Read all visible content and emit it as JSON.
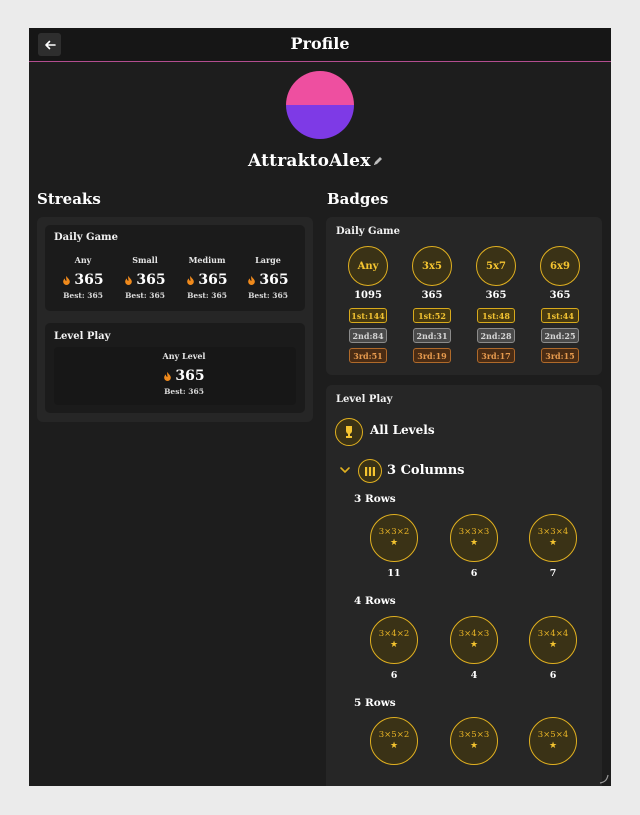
{
  "header": {
    "title": "Profile",
    "back_icon": "arrow-left-icon"
  },
  "profile": {
    "username": "AttraktoAlex",
    "avatar_colors": [
      "#ee4fa0",
      "#7e3ae6"
    ]
  },
  "streaks": {
    "title": "Streaks",
    "daily_game": {
      "title": "Daily Game",
      "items": [
        {
          "label": "Any",
          "value": "365",
          "best": "Best: 365"
        },
        {
          "label": "Small",
          "value": "365",
          "best": "Best: 365"
        },
        {
          "label": "Medium",
          "value": "365",
          "best": "Best: 365"
        },
        {
          "label": "Large",
          "value": "365",
          "best": "Best: 365"
        }
      ]
    },
    "level_play": {
      "title": "Level Play",
      "item": {
        "label": "Any Level",
        "value": "365",
        "best": "Best: 365"
      }
    }
  },
  "badges": {
    "title": "Badges",
    "daily_game": {
      "title": "Daily Game",
      "items": [
        {
          "label": "Any",
          "count": "1095",
          "first": "1st:144",
          "second": "2nd:84",
          "third": "3rd:51"
        },
        {
          "label": "3x5",
          "count": "365",
          "first": "1st:52",
          "second": "2nd:31",
          "third": "3rd:19"
        },
        {
          "label": "5x7",
          "count": "365",
          "first": "1st:48",
          "second": "2nd:28",
          "third": "3rd:17"
        },
        {
          "label": "6x9",
          "count": "365",
          "first": "1st:44",
          "second": "2nd:25",
          "third": "3rd:15"
        }
      ]
    },
    "level_play": {
      "title": "Level Play",
      "all_levels": "All Levels",
      "columns_group": "3 Columns",
      "rows": [
        {
          "title": "3 Rows",
          "badges": [
            {
              "label": "3×3×2",
              "count": "11"
            },
            {
              "label": "3×3×3",
              "count": "6"
            },
            {
              "label": "3×3×4",
              "count": "7"
            }
          ]
        },
        {
          "title": "4 Rows",
          "badges": [
            {
              "label": "3×4×2",
              "count": "6"
            },
            {
              "label": "3×4×3",
              "count": "4"
            },
            {
              "label": "3×4×4",
              "count": "6"
            }
          ]
        },
        {
          "title": "5 Rows",
          "badges": [
            {
              "label": "3×5×2",
              "count": ""
            },
            {
              "label": "3×5×3",
              "count": ""
            },
            {
              "label": "3×5×4",
              "count": ""
            }
          ]
        }
      ]
    }
  },
  "colors": {
    "accent_gold": "#e0b020",
    "header_border": "#b34d8f",
    "flame": "#f08a1c"
  }
}
